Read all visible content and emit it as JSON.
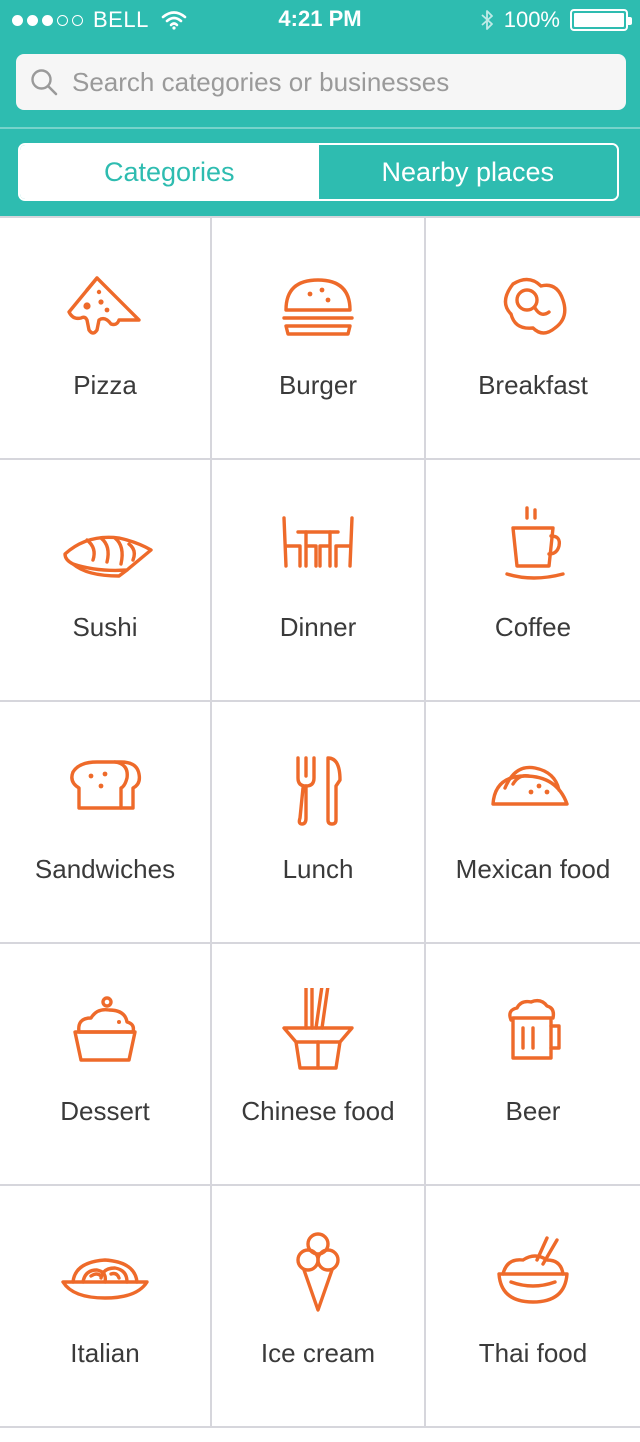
{
  "status_bar": {
    "carrier": "BELL",
    "time": "4:21 PM",
    "battery": "100%",
    "signal_bars_filled": 3,
    "signal_bars_total": 5
  },
  "search": {
    "placeholder": "Search categories or businesses",
    "icon": "search-icon"
  },
  "tabs": [
    {
      "label": "Categories",
      "active": true
    },
    {
      "label": "Nearby places",
      "active": false
    }
  ],
  "categories": [
    {
      "label": "Pizza",
      "icon": "pizza-icon"
    },
    {
      "label": "Burger",
      "icon": "burger-icon"
    },
    {
      "label": "Breakfast",
      "icon": "egg-icon"
    },
    {
      "label": "Sushi",
      "icon": "sushi-icon"
    },
    {
      "label": "Dinner",
      "icon": "table-chairs-icon"
    },
    {
      "label": "Coffee",
      "icon": "coffee-cup-icon"
    },
    {
      "label": "Sandwiches",
      "icon": "bread-icon"
    },
    {
      "label": "Lunch",
      "icon": "fork-knife-icon"
    },
    {
      "label": "Mexican food",
      "icon": "taco-icon"
    },
    {
      "label": "Dessert",
      "icon": "cupcake-icon"
    },
    {
      "label": "Chinese food",
      "icon": "takeout-box-icon"
    },
    {
      "label": "Beer",
      "icon": "beer-mug-icon"
    },
    {
      "label": "Italian",
      "icon": "pasta-plate-icon"
    },
    {
      "label": "Ice cream",
      "icon": "ice-cream-icon"
    },
    {
      "label": "Thai food",
      "icon": "rice-bowl-icon"
    }
  ],
  "colors": {
    "accent": "#2ebcb0",
    "icon": "#ee6a2a",
    "grid_line": "#d6d6dc"
  }
}
